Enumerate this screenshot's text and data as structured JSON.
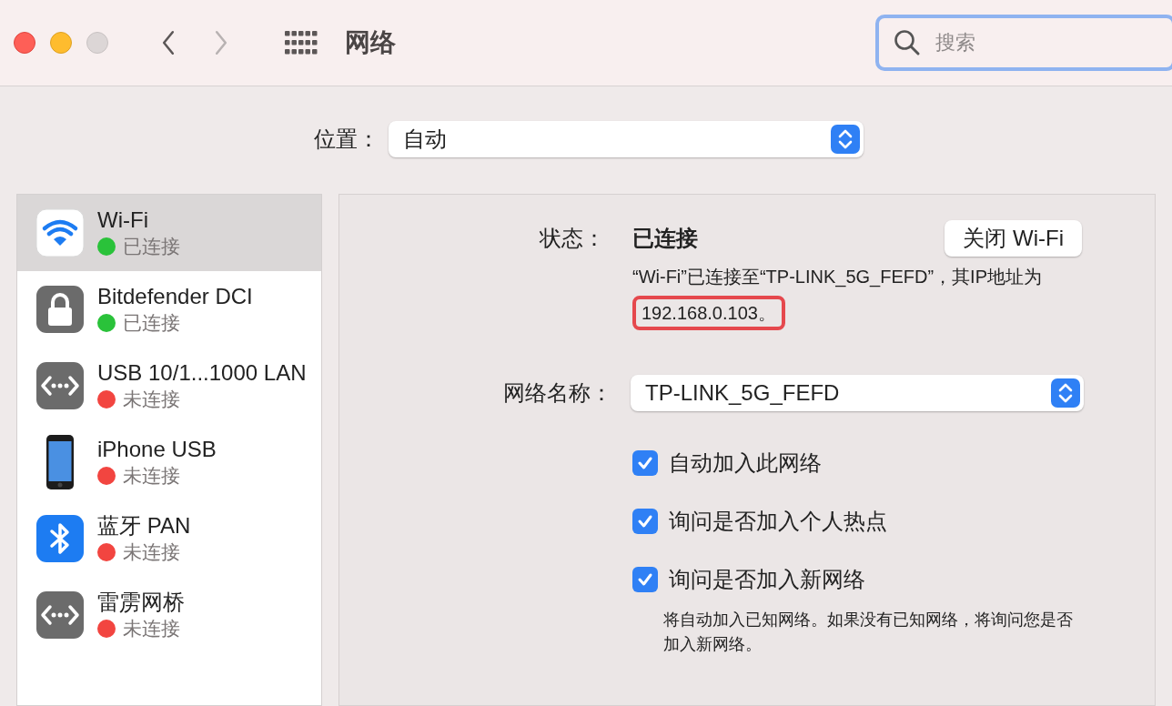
{
  "window": {
    "title": "网络"
  },
  "nav": [
    {
      "kind": "back",
      "disabled": false
    },
    {
      "kind": "forward",
      "disabled": true
    }
  ],
  "search": {
    "placeholder": "搜索"
  },
  "location": {
    "label": "位置：",
    "value": "自动"
  },
  "services": [
    {
      "name": "Wi-Fi",
      "status": "已连接",
      "connected": true,
      "kind": "wifi",
      "selected": true
    },
    {
      "name": "Bitdefender DCI",
      "status": "已连接",
      "connected": true,
      "kind": "lock",
      "selected": false
    },
    {
      "name": "USB 10/1...1000 LAN",
      "status": "未连接",
      "connected": false,
      "kind": "ethernet",
      "selected": false
    },
    {
      "name": "iPhone USB",
      "status": "未连接",
      "connected": false,
      "kind": "phone",
      "selected": false
    },
    {
      "name": "蓝牙 PAN",
      "status": "未连接",
      "connected": false,
      "kind": "bluetooth",
      "selected": false
    },
    {
      "name": "雷雳网桥",
      "status": "未连接",
      "connected": false,
      "kind": "ethernet",
      "selected": false
    }
  ],
  "detail": {
    "status_label": "状态：",
    "status_value": "已连接",
    "toggle_button": "关闭 Wi-Fi",
    "description": "“Wi-Fi”已连接至“TP-LINK_5G_FEFD”，其IP地址为",
    "highlighted": "192.168.0.103。",
    "network_label": "网络名称：",
    "network_value": "TP-LINK_5G_FEFD",
    "options": [
      {
        "label": "自动加入此网络",
        "checked": true
      },
      {
        "label": "询问是否加入个人热点",
        "checked": true
      },
      {
        "label": "询问是否加入新网络",
        "checked": true
      }
    ],
    "note": "将自动加入已知网络。如果没有已知网络，将询问您是否加入新网络。"
  }
}
